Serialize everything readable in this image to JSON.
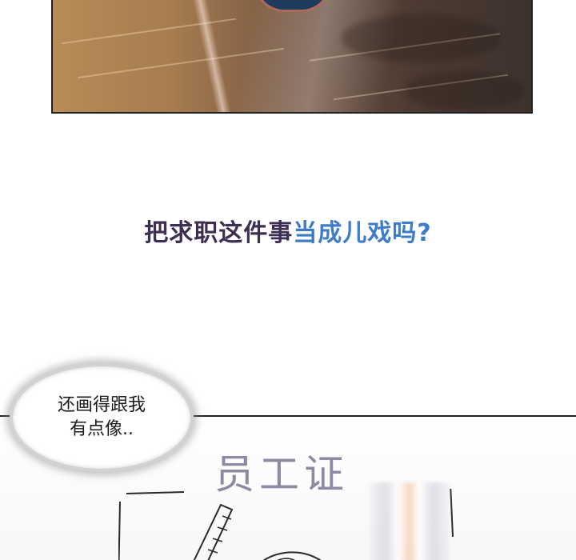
{
  "caption": {
    "part_a": "把求职这件事",
    "part_b": "当成儿戏吗?"
  },
  "speech_bubble": {
    "line1": "还画得跟我",
    "line2": "有点像.."
  },
  "badge": {
    "title": "员工证"
  },
  "colors": {
    "caption_dark": "#3d2f52",
    "caption_blue": "#3f7cc8",
    "badge_title": "#8e8aa3"
  }
}
